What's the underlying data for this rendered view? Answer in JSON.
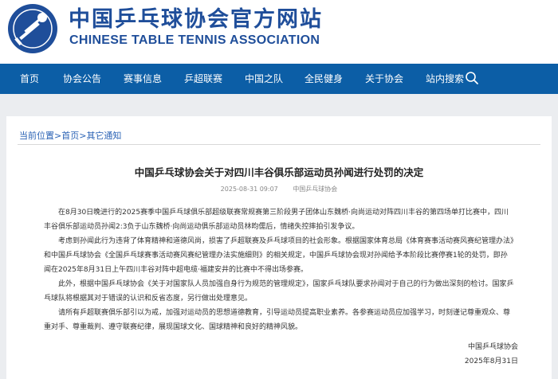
{
  "site": {
    "name_cn": "中国乒乓球协会官方网站",
    "name_en": "CHINESE TABLE TENNIS ASSOCIATION"
  },
  "nav": {
    "items": [
      "首页",
      "协会公告",
      "赛事信息",
      "乒超联赛",
      "中国之队",
      "全民健身",
      "关于协会",
      "站内搜索"
    ]
  },
  "breadcrumb": {
    "prefix": "当前位置",
    "items": [
      "首页",
      "其它通知"
    ],
    "separator": ">"
  },
  "article": {
    "title": "中国乒乓球协会关于对四川丰谷俱乐部运动员孙闻进行处罚的决定",
    "datetime": "2025-08-31 09:07",
    "source": "中国乒乓球协会",
    "paragraphs": [
      "在8月30日晚进行的2025赛季中国乒乓球俱乐部超级联赛常规赛第三阶段男子团体山东魏桥·向尚运动对阵四川丰谷的第四场单打比赛中，四川丰谷俱乐部运动员孙闻2:3负于山东魏桥·向尚运动俱乐部运动员林昀儒后，情绪失控摔拍引发争议。",
      "考虑到孙闻此行为违背了体育精神和道德风尚，损害了乒超联赛及乒乓球项目的社会形象。根据国家体育总局《体育赛事活动赛风赛纪管理办法》和中国乒乓球协会《全国乒乓球赛事活动赛风赛纪管理办法实施细则》的相关规定，中国乒乓球协会现对孙闻给予本阶段比赛停赛1轮的处罚，即孙闻在2025年8月31日上午四川丰谷对阵中超电缆·福建安井的比赛中不得出场参赛。",
      "此外，根据中国乒乓球协会《关于对国家队人员加强自身行为规范的管理规定》，国家乒乓球队要求孙闻对于自己的行为做出深刻的检讨。国家乒乓球队将根据其对于错误的认识和反省态度，另行做出处理意见。",
      "请所有乒超联赛俱乐部引以为戒，加强对运动员的思想道德教育，引导运动员提高职业素养。各参赛运动员应加强学习，时刻谨记尊重观众、尊重对手、尊重裁判、遵守联赛纪律，展现国球文化、国球精神和良好的精神风貌。"
    ],
    "signature": "中国乒乓球协会",
    "sign_date": "2025年8月31日"
  },
  "colors": {
    "nav_bg": "#0c5ea6",
    "brand": "#1f4e9a",
    "link": "#2b63b5"
  }
}
